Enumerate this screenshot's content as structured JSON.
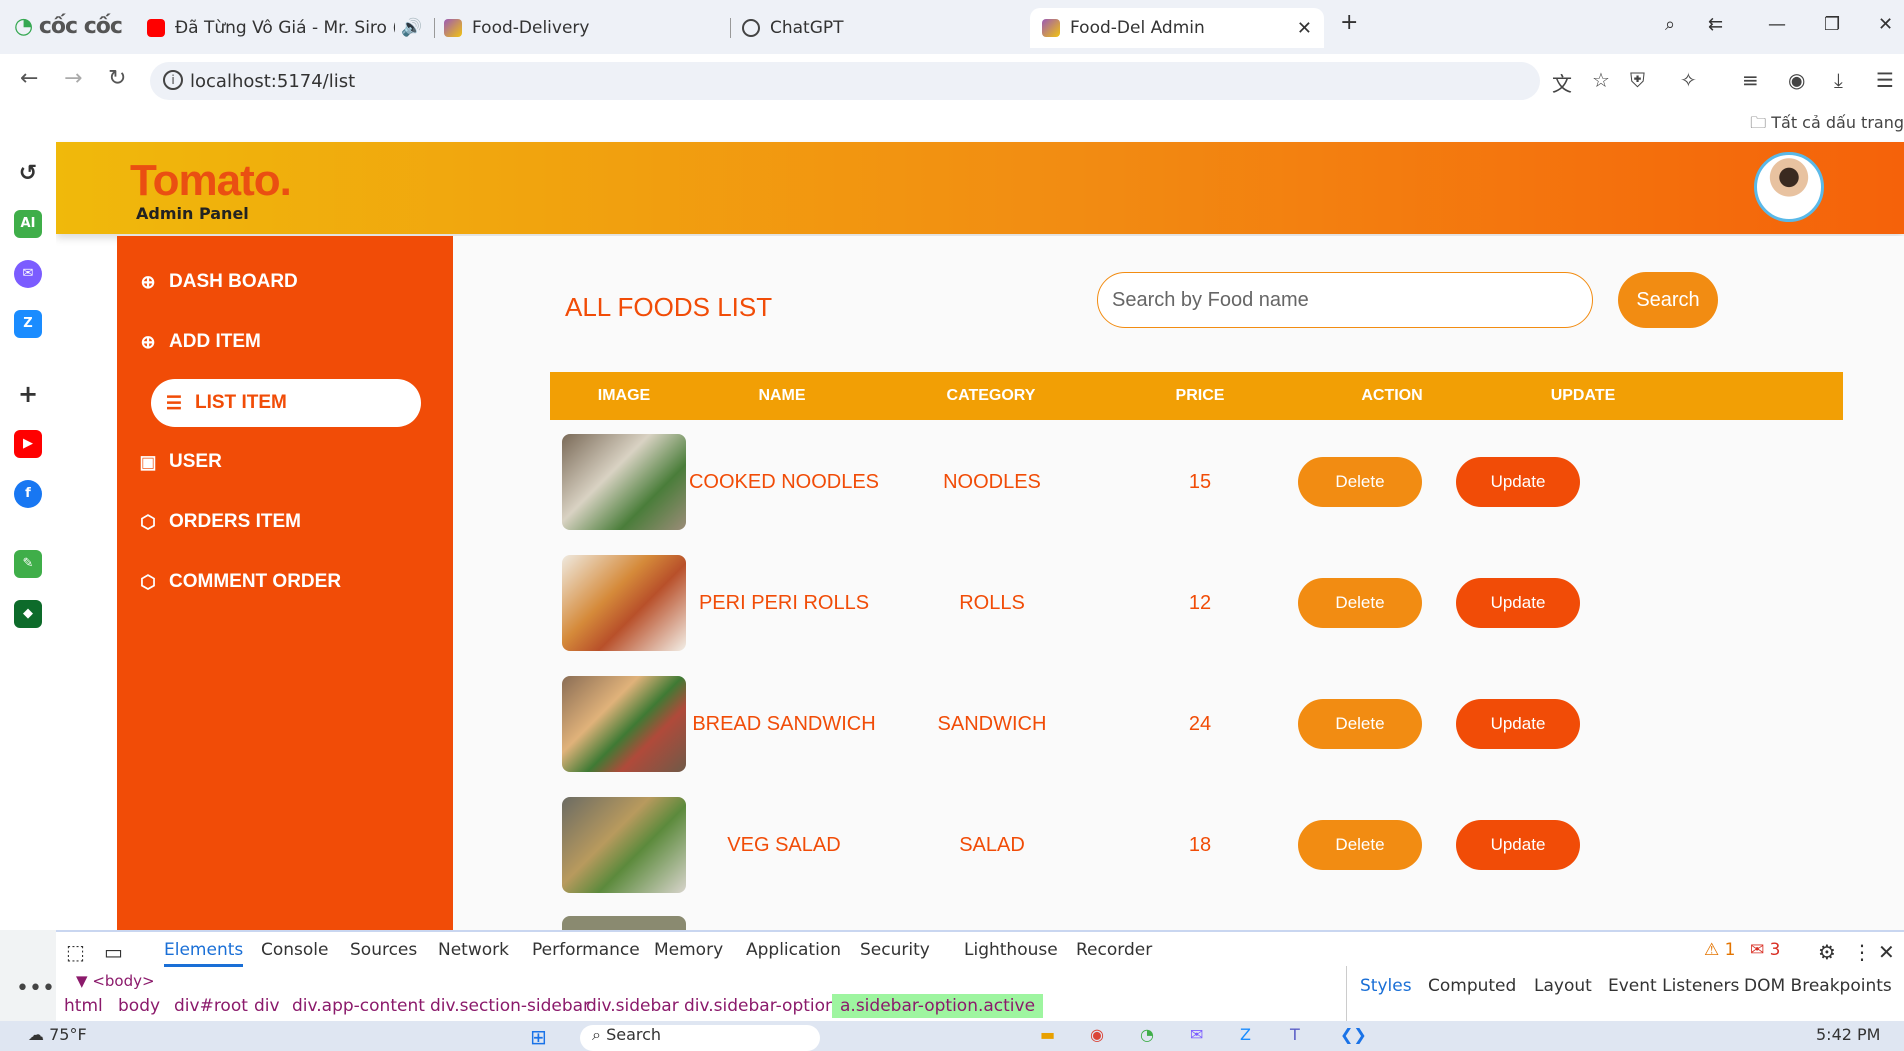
{
  "browser": {
    "tabs": [
      {
        "label": "Đã Từng Vô Giá - Mr. Siro (Offi",
        "fav_color": "#ff0000"
      },
      {
        "label": "Food-Delivery",
        "fav_color": "#9b59b6"
      },
      {
        "label": "ChatGPT",
        "fav_color": "#444444"
      },
      {
        "label": "Food-Del Admin",
        "fav_color": "#9b59b6"
      }
    ],
    "logo": "cốc cốc",
    "url": "localhost:5174/list",
    "bookmarks_label": "Tất cả dấu trang"
  },
  "header": {
    "brand": "Tomato.",
    "subtitle": "Admin Panel"
  },
  "sidebar": {
    "items": [
      {
        "label": "DASH BOARD",
        "icon": "plus-circle-icon",
        "glyph": "⊕"
      },
      {
        "label": "ADD ITEM",
        "icon": "plus-circle-icon",
        "glyph": "⊕"
      },
      {
        "label": "LIST ITEM",
        "icon": "list-icon",
        "glyph": "☰",
        "active": true
      },
      {
        "label": "USER",
        "icon": "user-icon",
        "glyph": "▣"
      },
      {
        "label": "ORDERS ITEM",
        "icon": "box-icon",
        "glyph": "⬡"
      },
      {
        "label": "COMMENT ORDER",
        "icon": "box-icon",
        "glyph": "⬡"
      }
    ]
  },
  "main": {
    "title": "ALL FOODS LIST",
    "search_placeholder": "Search by Food name",
    "search_button": "Search",
    "columns": [
      "IMAGE",
      "NAME",
      "CATEGORY",
      "PRICE",
      "ACTION",
      "UPDATE"
    ],
    "rows": [
      {
        "name": "COOKED NOODLES",
        "category": "NOODLES",
        "price": "15",
        "delete": "Delete",
        "update": "Update",
        "img": "linear-gradient(135deg,#7a6a58,#d9d2c3 40%,#4a7d3a 70%,#9b8c78)"
      },
      {
        "name": "PERI PERI ROLLS",
        "category": "ROLLS",
        "price": "12",
        "delete": "Delete",
        "update": "Update",
        "img": "linear-gradient(135deg,#efe9df,#d58a3a 40%,#b8502a 60%,#f3efe7)"
      },
      {
        "name": "BREAD SANDWICH",
        "category": "SANDWICH",
        "price": "24",
        "delete": "Delete",
        "update": "Update",
        "img": "linear-gradient(135deg,#8a6d55,#e0b27a 35%,#3f7a34 55%,#b04a3a 70%,#6f5a48)"
      },
      {
        "name": "VEG SALAD",
        "category": "SALAD",
        "price": "18",
        "delete": "Delete",
        "update": "Update",
        "img": "linear-gradient(135deg,#6b6b63,#b89a5e 40%,#5c8a3c 60%,#d8d4cc)"
      }
    ]
  },
  "devtools": {
    "tabs": [
      "Elements",
      "Console",
      "Sources",
      "Network",
      "Performance",
      "Memory",
      "Application",
      "Security",
      "Lighthouse",
      "Recorder"
    ],
    "warnings": "1",
    "errors": "3",
    "body_tag": "<body>",
    "breadcrumbs": [
      "html",
      "body",
      "div#root",
      "div",
      "div.app-content",
      "div.section-sidebar",
      "div.sidebar",
      "div.sidebar-options",
      "a.sidebar-option.active"
    ],
    "style_tabs": [
      "Styles",
      "Computed",
      "Layout",
      "Event Listeners",
      "DOM Breakpoints"
    ]
  },
  "taskbar": {
    "weather": "75°F",
    "search": "Search",
    "time": "5:42 PM"
  }
}
